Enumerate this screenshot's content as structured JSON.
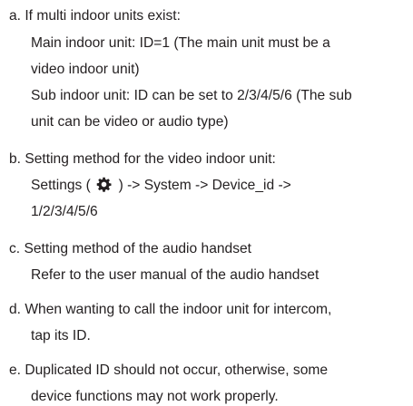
{
  "items": [
    {
      "lines": [
        "a. If multi indoor units exist:",
        "Main indoor unit: ID=1 (The main unit must be a",
        "video indoor unit)",
        "Sub indoor unit: ID can be set to 2/3/4/5/6 (The sub",
        "unit can be video or audio type)"
      ]
    },
    {
      "lines": [
        "b. Setting method for the video indoor unit:",
        "",
        "1/2/3/4/5/6"
      ],
      "settings_line": {
        "before": "Settings (",
        "icon": "gear-icon",
        "after": ") -> System -> Device_id ->"
      }
    },
    {
      "lines": [
        "c. Setting method of the audio handset",
        "Refer to the user manual of the audio handset"
      ]
    },
    {
      "lines": [
        "d. When wanting to call the indoor unit for intercom,",
        "tap its ID."
      ]
    },
    {
      "lines": [
        "e. Duplicated ID should not occur, otherwise, some",
        "device functions may not work properly."
      ]
    }
  ]
}
